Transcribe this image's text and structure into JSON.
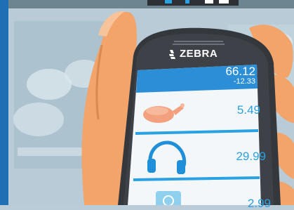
{
  "device": {
    "brand": "ZEBRA"
  },
  "screen": {
    "header": {
      "total": "66.12",
      "subtotal": "-12.33"
    },
    "items": [
      {
        "icon": "chicken-icon",
        "price": "5.49"
      },
      {
        "icon": "headphones-icon",
        "price": "29.99"
      },
      {
        "icon": "item-icon",
        "price": "2.99"
      }
    ]
  },
  "colors": {
    "accent": "#2aa1e2",
    "header_blue": "#2b8ed6",
    "device_body": "#3a3d42",
    "skin": "#f2a46a"
  }
}
